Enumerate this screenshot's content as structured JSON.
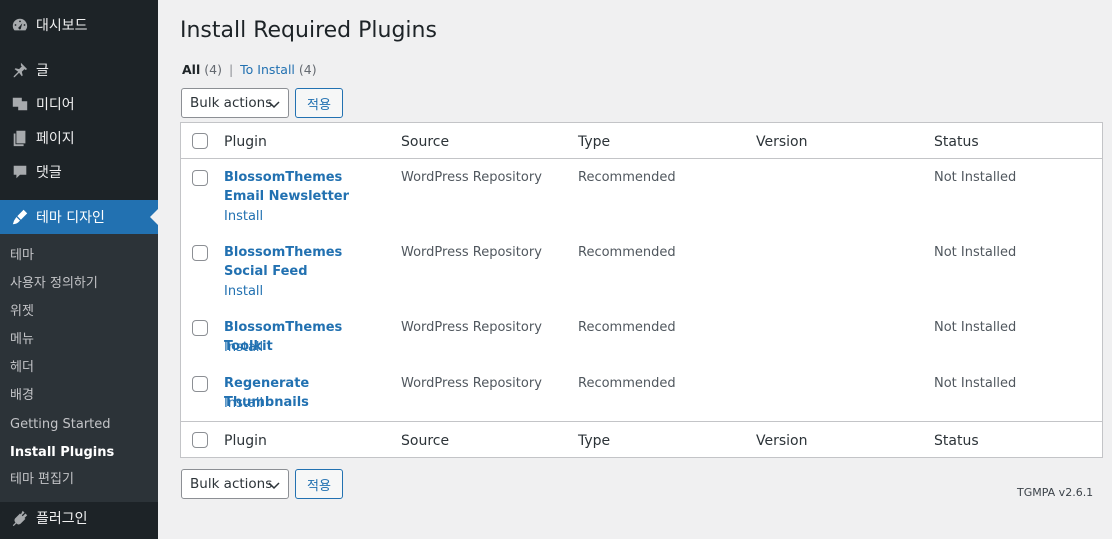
{
  "sidebar": {
    "items": [
      {
        "label": "대시보드",
        "icon": "dashboard-icon"
      },
      {
        "label": "글",
        "icon": "pin-icon"
      },
      {
        "label": "미디어",
        "icon": "media-icon"
      },
      {
        "label": "페이지",
        "icon": "page-icon"
      },
      {
        "label": "댓글",
        "icon": "comment-icon"
      },
      {
        "label": "테마 디자인",
        "icon": "brush-icon"
      },
      {
        "label": "플러그인",
        "icon": "plugin-icon"
      }
    ],
    "submenu": [
      "테마",
      "사용자 정의하기",
      "위젯",
      "메뉴",
      "헤더",
      "배경",
      "Getting Started",
      "Install Plugins",
      "테마 편집기"
    ]
  },
  "main": {
    "title": "Install Required Plugins",
    "filters": {
      "all_label": "All",
      "all_count": "(4)",
      "separator": "|",
      "to_install_label": "To Install",
      "to_install_count": "(4)"
    },
    "bulk_actions_label": "Bulk actions",
    "apply_label": "적용",
    "columns": [
      "Plugin",
      "Source",
      "Type",
      "Version",
      "Status"
    ],
    "rows": [
      {
        "plugin": "BlossomThemes Email Newsletter",
        "action": "Install",
        "source": "WordPress Repository",
        "type": "Recommended",
        "version": "",
        "status": "Not Installed"
      },
      {
        "plugin": "BlossomThemes Social Feed",
        "action": "Install",
        "source": "WordPress Repository",
        "type": "Recommended",
        "version": "",
        "status": "Not Installed"
      },
      {
        "plugin": "BlossomThemes Toolkit",
        "action": "Install",
        "source": "WordPress Repository",
        "type": "Recommended",
        "version": "",
        "status": "Not Installed"
      },
      {
        "plugin": "Regenerate Thumbnails",
        "action": "Install",
        "source": "WordPress Repository",
        "type": "Recommended",
        "version": "",
        "status": "Not Installed"
      }
    ],
    "version_footer": "TGMPA v2.6.1"
  },
  "colors": {
    "sidebar_bg": "#1d2327",
    "accent": "#2271b1",
    "page_bg": "#f0f0f1"
  }
}
